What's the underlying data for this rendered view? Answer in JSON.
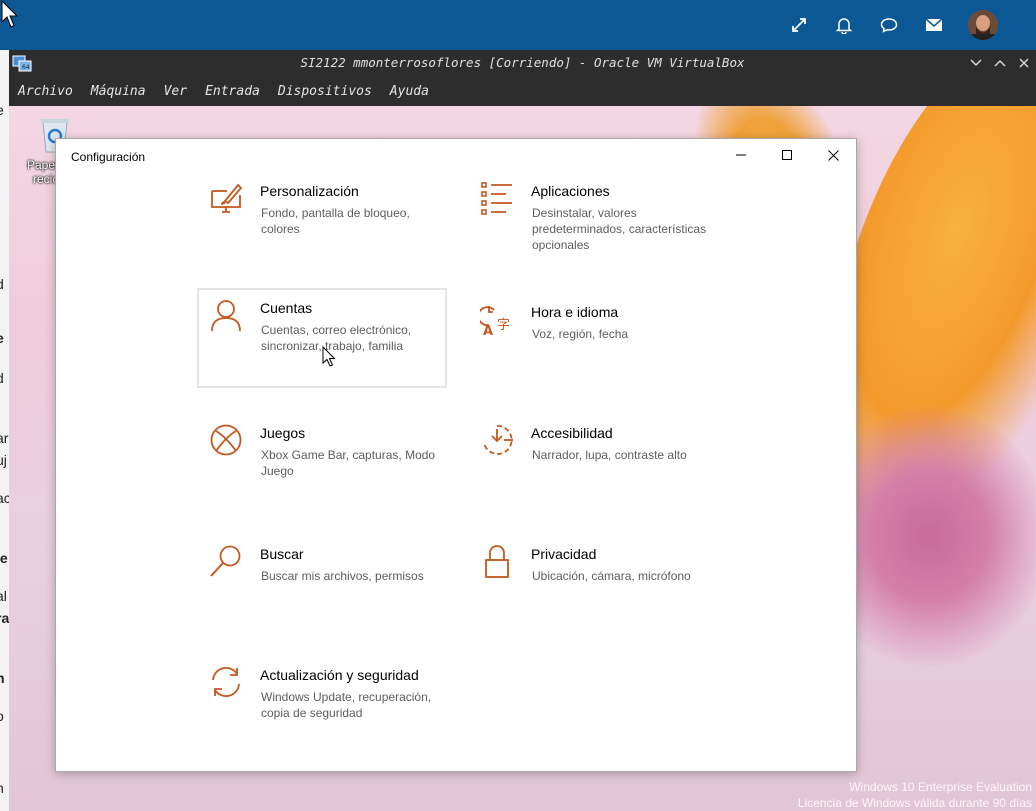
{
  "host": {
    "icons": [
      "fullscreen-icon",
      "bell-icon",
      "chat-icon",
      "mail-icon"
    ]
  },
  "vbox": {
    "title": "SI2122 mmonterrosoflores [Corriendo] - Oracle VM VirtualBox",
    "menu": [
      "Archivo",
      "Máquina",
      "Ver",
      "Entrada",
      "Dispositivos",
      "Ayuda"
    ]
  },
  "desktop": {
    "recycle_label_1": "Papelera de",
    "recycle_label_2": "reciclaje",
    "watermark_1": "Windows 10 Enterprise Evaluation",
    "watermark_2": "Licencia de Windows válida durante 90 días"
  },
  "settings": {
    "title": "Configuración",
    "accent": "#c4581f",
    "tiles": [
      {
        "name": "Personalización",
        "desc": "Fondo, pantalla de bloqueo, colores",
        "icon": "personalization-icon"
      },
      {
        "name": "Aplicaciones",
        "desc": "Desinstalar, valores predeterminados, características opcionales",
        "icon": "apps-icon"
      },
      {
        "name": "Cuentas",
        "desc": "Cuentas, correo electrónico, sincronizar, trabajo, familia",
        "icon": "accounts-icon"
      },
      {
        "name": "Hora e idioma",
        "desc": "Voz, región, fecha",
        "icon": "time-language-icon"
      },
      {
        "name": "Juegos",
        "desc": "Xbox Game Bar, capturas, Modo Juego",
        "icon": "xbox-icon"
      },
      {
        "name": "Accesibilidad",
        "desc": "Narrador, lupa, contraste alto",
        "icon": "accessibility-icon"
      },
      {
        "name": "Buscar",
        "desc": "Buscar mis archivos, permisos",
        "icon": "search-icon"
      },
      {
        "name": "Privacidad",
        "desc": "Ubicación, cámara, micrófono",
        "icon": "lock-icon"
      },
      {
        "name": "Actualización y seguridad",
        "desc": "Windows Update, recuperación, copia de seguridad",
        "icon": "update-icon"
      }
    ]
  },
  "left_strip": [
    "e",
    "e",
    "d",
    "ar",
    "uj",
    "ac",
    "le",
    "al",
    "ra",
    "n",
    "o",
    "h"
  ]
}
